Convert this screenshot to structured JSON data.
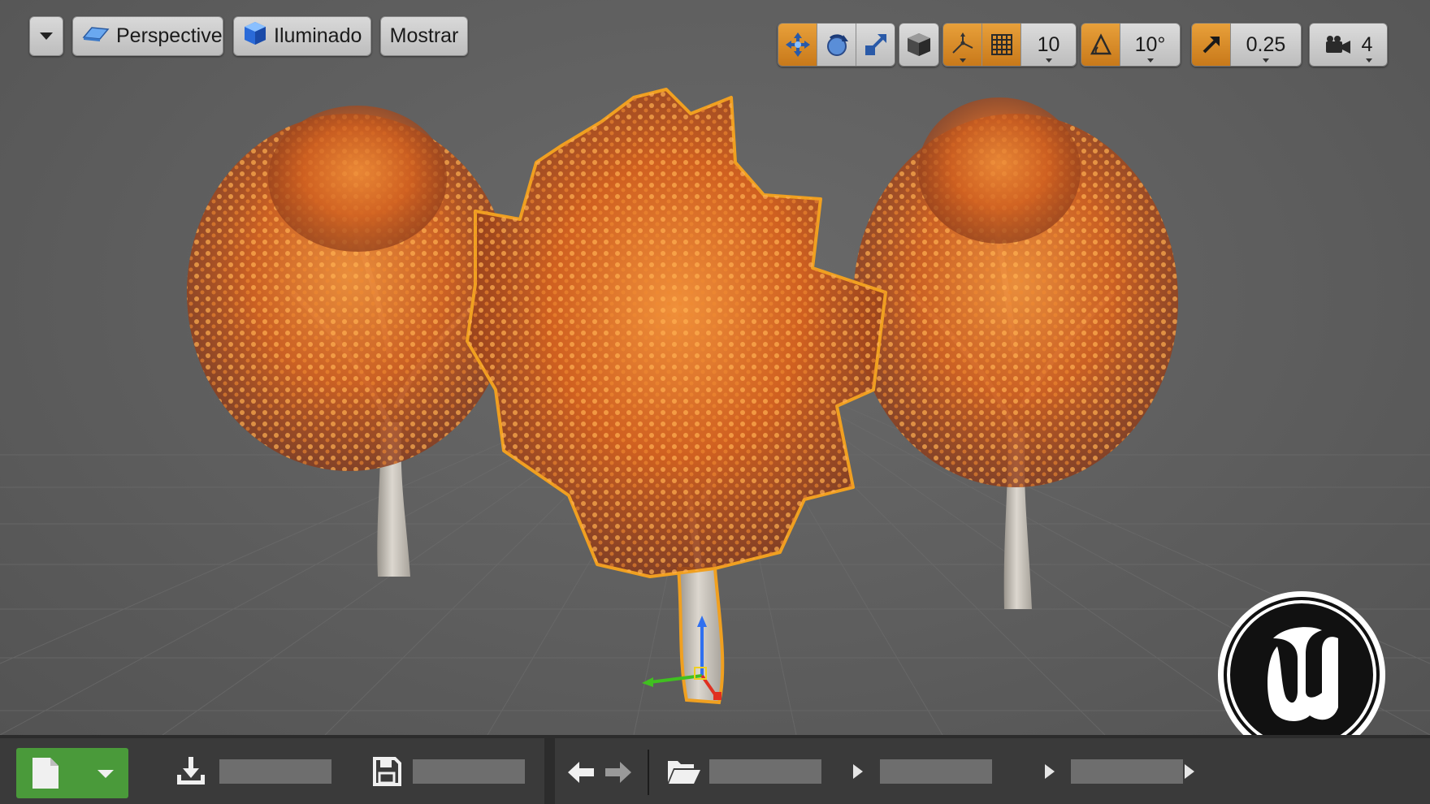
{
  "viewport_toolbar": {
    "options_dropdown_icon": "caret-down-icon",
    "view_mode": {
      "icon": "perspective-icon",
      "label": "Perspective"
    },
    "lighting_mode": {
      "icon": "lit-cube-icon",
      "label": "Iluminado"
    },
    "show_label": "Mostrar"
  },
  "transform_toolbar": {
    "tools": [
      {
        "icon": "translate-icon",
        "active": true
      },
      {
        "icon": "rotate-icon",
        "active": false
      },
      {
        "icon": "scale-icon",
        "active": false
      },
      {
        "icon": "world-local-cube-icon",
        "active": false
      }
    ],
    "surface_snap_icon": "surface-snap-icon",
    "grid_snap": {
      "icon": "grid-icon",
      "value": "10"
    },
    "rotation_snap": {
      "icon": "angle-icon",
      "value": "10°"
    },
    "scale_snap": {
      "icon": "scale-arrow-icon",
      "value": "0.25"
    },
    "camera_speed": {
      "icon": "camera-icon",
      "value": "4"
    }
  },
  "scene": {
    "selected_object": "center-tree",
    "colors": {
      "selection_outline": "#f0a020",
      "foliage": "#d86a1e",
      "trunk": "#cfcac2",
      "gizmo_x": "#e03020",
      "gizmo_y": "#40c020",
      "gizmo_z": "#3070f0"
    },
    "logo": "unreal-engine-logo"
  },
  "bottom_bar": {
    "new_button_icon": "new-file-icon",
    "new_dropdown_icon": "caret-down-icon",
    "import_icon": "download-icon",
    "save_icon": "save-icon",
    "back_icon": "arrow-left-icon",
    "forward_icon": "arrow-right-icon",
    "folder_icon": "folder-open-icon",
    "path_separator_icon": "chevron-right-icon",
    "accent_color": "#4a9a3a"
  }
}
